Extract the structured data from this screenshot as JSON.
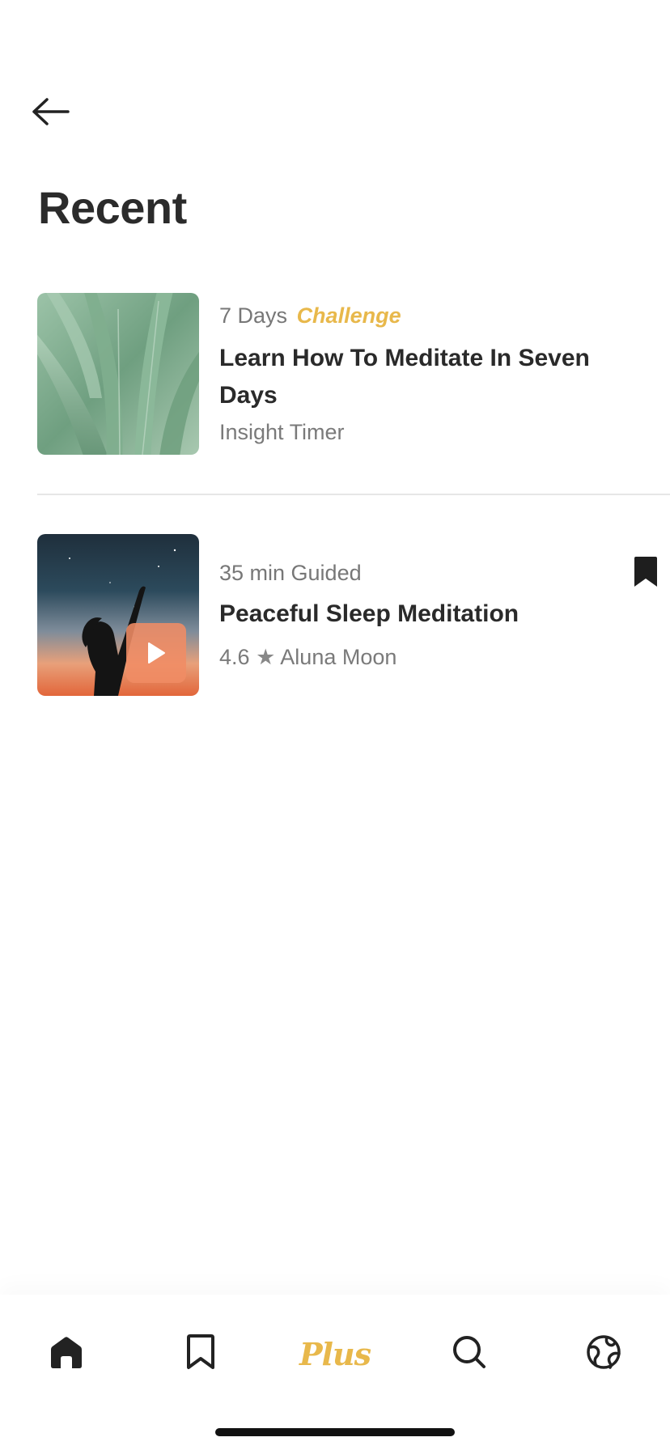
{
  "header": {
    "back_icon": "arrow-left-icon",
    "title": "Recent"
  },
  "items": [
    {
      "thumbnail": "agave-plant-image",
      "meta_prefix": "7 Days",
      "meta_accent": "Challenge",
      "title": "Learn How To Meditate In Seven Days",
      "subtitle": "Insight Timer"
    },
    {
      "thumbnail": "night-sky-silhouette-image",
      "meta_prefix": "35 min Guided",
      "title": "Peaceful Sleep Meditation",
      "rating": "4.6",
      "star": "★",
      "author": "Aluna Moon",
      "bookmark_icon": "bookmark-filled-icon",
      "play_icon": "play-icon"
    }
  ],
  "tab_bar": {
    "tabs": [
      {
        "name": "home",
        "icon": "home-icon"
      },
      {
        "name": "saved",
        "icon": "bookmark-icon"
      },
      {
        "name": "plus",
        "label": "Plus"
      },
      {
        "name": "search",
        "icon": "search-icon"
      },
      {
        "name": "community",
        "icon": "globe-icon"
      }
    ]
  },
  "colors": {
    "accent": "#e8b84b",
    "text_primary": "#2a2a2a",
    "text_secondary": "#777777",
    "play_button": "#f08c64"
  }
}
